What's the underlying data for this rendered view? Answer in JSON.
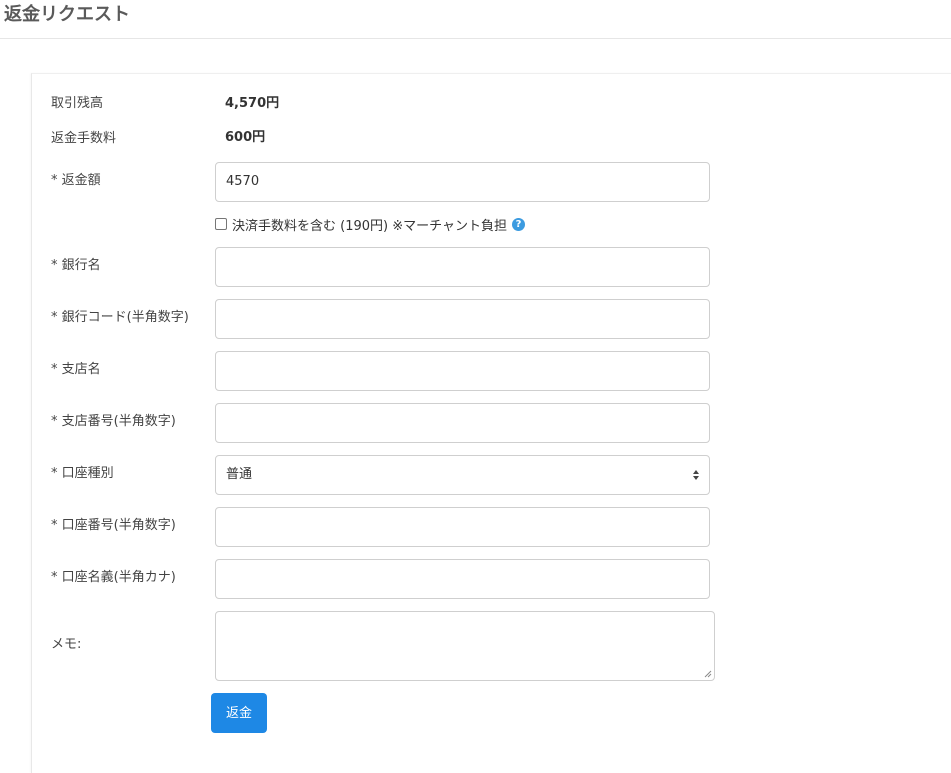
{
  "page": {
    "title": "返金リクエスト"
  },
  "summary": {
    "balance_label": "取引残高",
    "balance_value": "4,570円",
    "fee_label": "返金手数料",
    "fee_value": "600円"
  },
  "form": {
    "refund_amount": {
      "label": "* 返金額",
      "value": "4570"
    },
    "include_fee": {
      "label": "決済手数料を含む (190円) ※マーチャント負担",
      "checked": false,
      "help_icon": "question-circle-icon"
    },
    "bank_name": {
      "label": "* 銀行名",
      "value": ""
    },
    "bank_code": {
      "label": "* 銀行コード(半角数字)",
      "value": ""
    },
    "branch_name": {
      "label": "* 支店名",
      "value": ""
    },
    "branch_code": {
      "label": "* 支店番号(半角数字)",
      "value": ""
    },
    "account_type": {
      "label": "* 口座種別",
      "selected": "普通"
    },
    "account_number": {
      "label": "* 口座番号(半角数字)",
      "value": ""
    },
    "account_holder": {
      "label": "* 口座名義(半角カナ)",
      "value": ""
    },
    "memo": {
      "label": "メモ:",
      "value": ""
    },
    "submit_label": "返金"
  },
  "colors": {
    "primary": "#1e88e5",
    "help_icon": "#3c9be0",
    "title": "#5a5a5a",
    "border": "#cfcfcf"
  }
}
